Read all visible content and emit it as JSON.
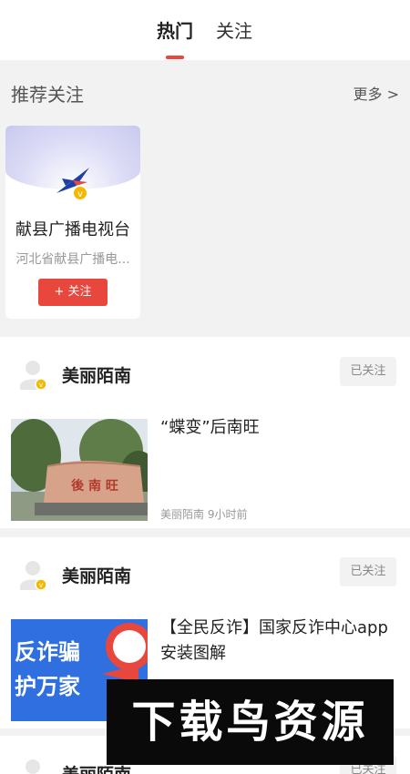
{
  "tabs": {
    "hot": "热门",
    "follow": "关注"
  },
  "recommend": {
    "title": "推荐关注",
    "more": "更多 >",
    "card": {
      "name": "献县广播电视台",
      "desc": "河北省献县广播电...",
      "follow_btn": "+ 关注"
    }
  },
  "feed": [
    {
      "author": "美丽陌南",
      "followed_label": "已关注",
      "title": "“蝶变”后南旺",
      "meta": "美丽陌南  9小时前",
      "thumb_stone_text": "後 南 旺"
    },
    {
      "author": "美丽陌南",
      "followed_label": "已关注",
      "title": "【全民反诈】国家反诈中心app安装图解",
      "thumb_text_1": "反诈骗",
      "thumb_text_2": "护万家"
    },
    {
      "author": "美丽陌南",
      "followed_label": "已关注"
    }
  ],
  "watermark": "下载鸟资源",
  "colors": {
    "accent": "#e8473d",
    "badge": "#f5b800",
    "banner_blue": "#2f6fe0"
  }
}
